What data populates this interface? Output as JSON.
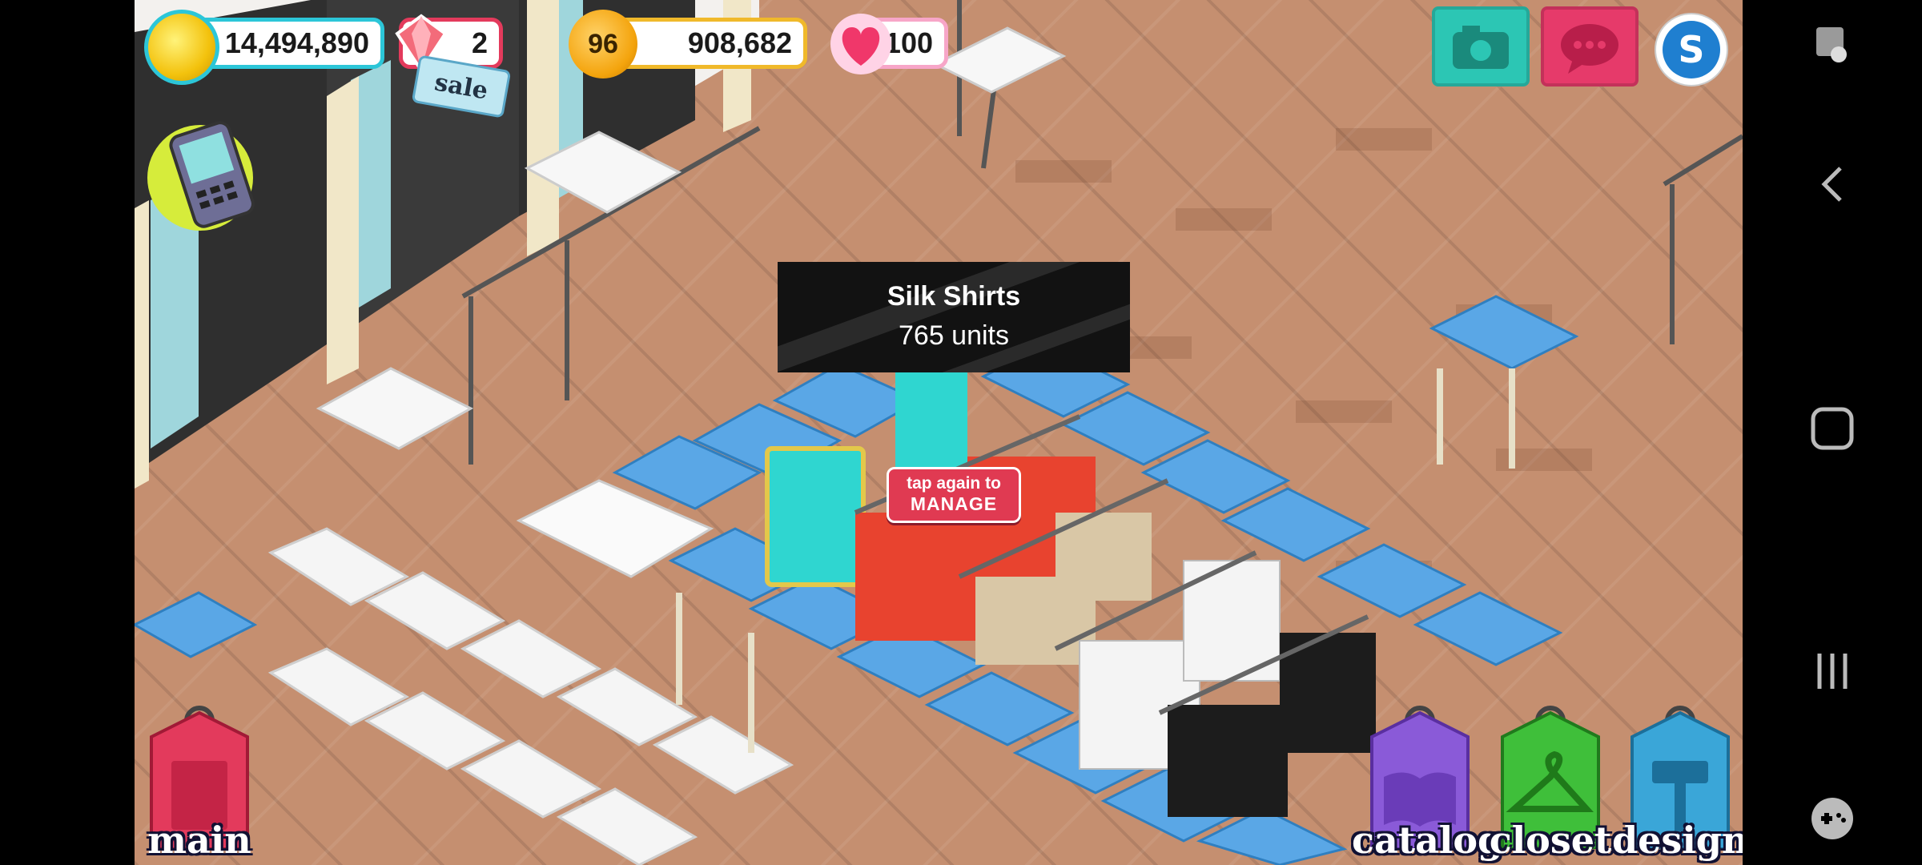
{
  "hud": {
    "coins": "14,494,890",
    "gems": "2",
    "sale_label": "sale",
    "level": "96",
    "xp": "908,682",
    "hearts": "100"
  },
  "tooltip": {
    "title": "Silk Shirts",
    "subtitle": "765 units"
  },
  "tap_tag": {
    "line1": "tap again to",
    "line2": "MANAGE"
  },
  "bottom_buttons": {
    "main": "main",
    "catalog": "catalog",
    "closet": "closet",
    "design": "design"
  },
  "colors": {
    "floor": "#c58f70",
    "counter_blue": "#5aa7e6",
    "shirt_teal": "#2fd6d0",
    "shirt_red": "#e8432f",
    "main_pink": "#e33a5c",
    "catalog_purple": "#8a5ad8",
    "closet_green": "#3fbf3a",
    "design_blue": "#3aa6d8",
    "camera_teal": "#2cc6b4",
    "chat_pink": "#e63a6a"
  },
  "icons": [
    "coin-icon",
    "gem-icon",
    "star-icon",
    "heart-icon",
    "phone-icon",
    "camera-icon",
    "chat-icon",
    "s-icon",
    "notebook-icon",
    "book-icon",
    "hanger-icon",
    "hammer-icon",
    "back-icon",
    "home-icon",
    "recents-icon",
    "gamepad-icon"
  ]
}
